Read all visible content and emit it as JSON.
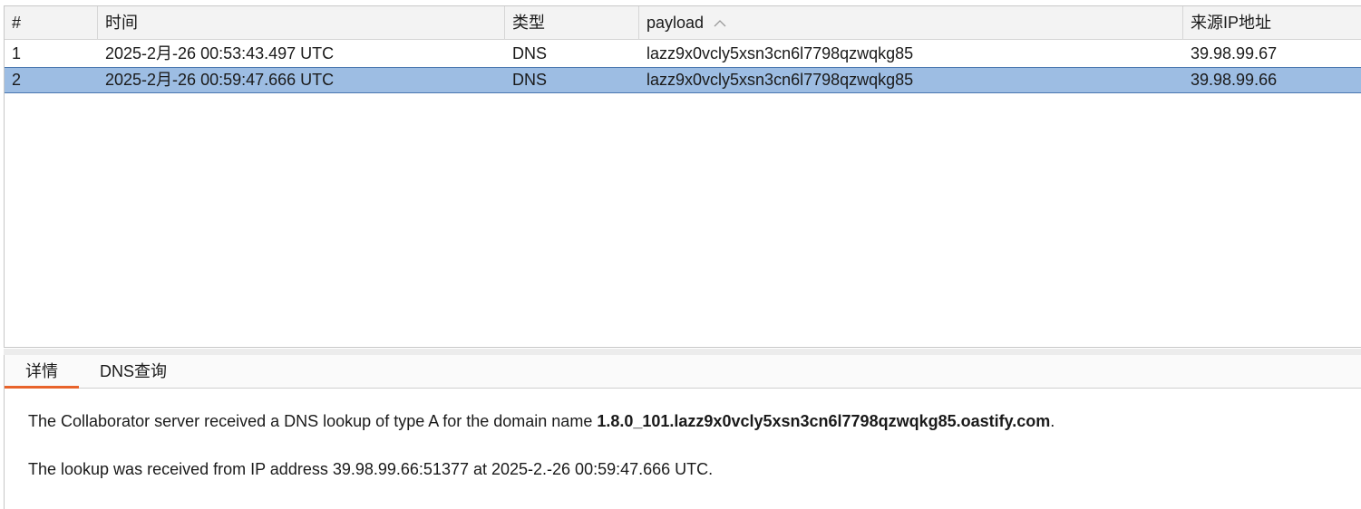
{
  "table": {
    "columns": [
      "#",
      "时间",
      "类型",
      "payload",
      "来源IP地址"
    ],
    "sort_column": "payload",
    "sort_icon": "chevron-up-icon",
    "rows": [
      {
        "num": "1",
        "time": "2025-2月-26 00:53:43.497 UTC",
        "type": "DNS",
        "payload": "lazz9x0vcly5xsn3cn6l7798qzwqkg85",
        "ip": "39.98.99.67",
        "selected": false
      },
      {
        "num": "2",
        "time": "2025-2月-26 00:59:47.666 UTC",
        "type": "DNS",
        "payload": "lazz9x0vcly5xsn3cn6l7798qzwqkg85",
        "ip": "39.98.99.66",
        "selected": true
      }
    ]
  },
  "detail": {
    "tabs": [
      {
        "label": "详情",
        "active": true
      },
      {
        "label": "DNS查询",
        "active": false
      }
    ],
    "line1_prefix": "The Collaborator server received a DNS lookup of type A for the domain name ",
    "line1_domain": "1.8.0_101.lazz9x0vcly5xsn3cn6l7798qzwqkg85.oastify.com",
    "line1_suffix": ".",
    "line2": "The lookup was received from IP address 39.98.99.66:51377 at 2025-2.-26 00:59:47.666 UTC."
  },
  "colors": {
    "selected_row": "#9dbde3",
    "selected_border": "#4a77b0",
    "active_tab_underline": "#e8632b",
    "header_bg": "#f3f3f3"
  }
}
